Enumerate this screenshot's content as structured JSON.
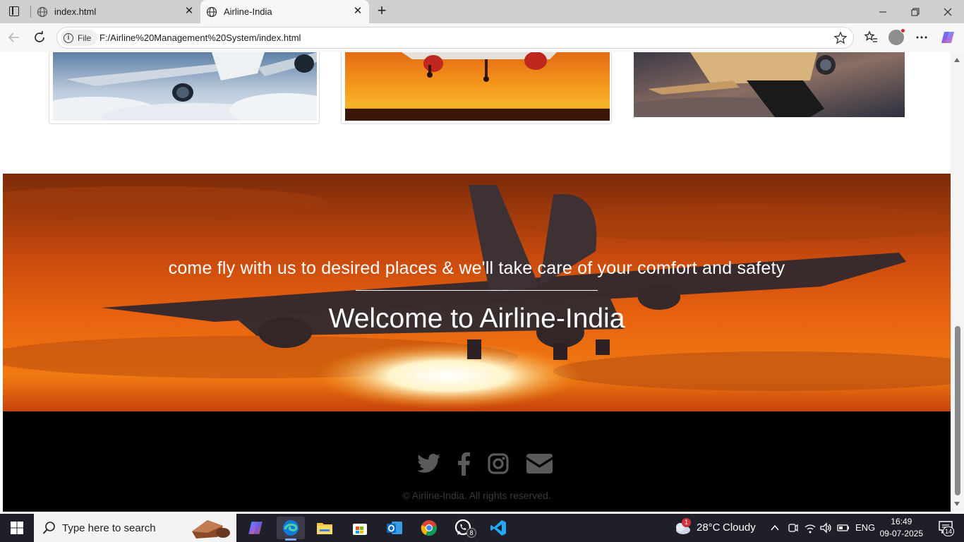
{
  "browser": {
    "tabs": [
      {
        "title": "index.html",
        "active": false
      },
      {
        "title": "Airline-India",
        "active": true
      }
    ],
    "address_bar": {
      "scheme_label": "File",
      "url": "F:/Airline%20Management%20System/index.html"
    }
  },
  "page": {
    "hero": {
      "tagline": "come fly with us to desired places & we'll take care of your comfort and safety",
      "heading": "Welcome to Airline-India"
    },
    "footer": {
      "social": [
        "twitter-icon",
        "facebook-icon",
        "instagram-icon",
        "envelope-icon"
      ],
      "copyright": "© Airline-India. All rights reserved."
    }
  },
  "taskbar": {
    "search_placeholder": "Type here to search",
    "weather": {
      "temperature": "28°C",
      "condition": "Cloudy",
      "badge": "1"
    },
    "language": "ENG",
    "time": "16:49",
    "date": "09-07-2025",
    "notifications": "14",
    "whatsapp_badge": "8"
  },
  "colors": {
    "accent_edge": "#0f7bd8",
    "footer_bg": "#000000",
    "taskbar_bg": "#1f1f2a"
  }
}
